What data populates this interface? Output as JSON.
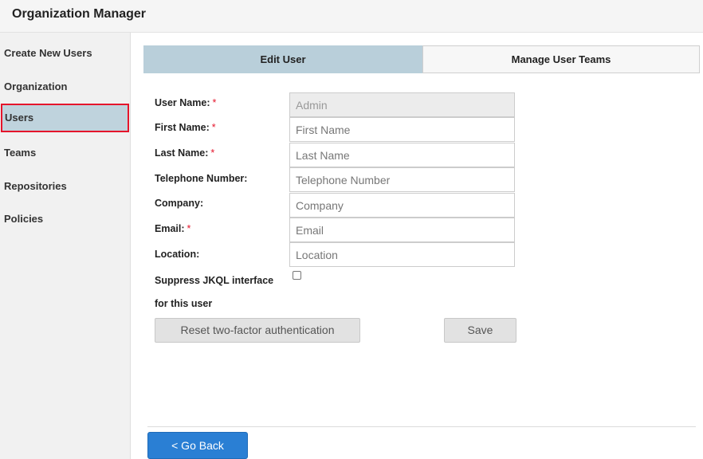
{
  "header": {
    "title": "Organization Manager"
  },
  "sidebar": {
    "items": [
      {
        "label": "Create New Users"
      },
      {
        "label": "Organization"
      },
      {
        "label": "Users"
      },
      {
        "label": "Teams"
      },
      {
        "label": "Repositories"
      },
      {
        "label": "Policies"
      }
    ],
    "selected": "Users"
  },
  "tabs": [
    {
      "label": "Edit User",
      "active": true
    },
    {
      "label": "Manage User Teams",
      "active": false
    }
  ],
  "form": {
    "required_mark": "*",
    "fields": [
      {
        "label": "User Name:",
        "required": true,
        "value": "Admin",
        "placeholder": "",
        "disabled": true
      },
      {
        "label": "First Name:",
        "required": true,
        "value": "",
        "placeholder": "First Name"
      },
      {
        "label": "Last Name:",
        "required": true,
        "value": "",
        "placeholder": "Last Name"
      },
      {
        "label": "Telephone Number:",
        "required": false,
        "value": "",
        "placeholder": "Telephone Number"
      },
      {
        "label": "Company:",
        "required": false,
        "value": "",
        "placeholder": "Company"
      },
      {
        "label": "Email:",
        "required": true,
        "value": "",
        "placeholder": "Email"
      },
      {
        "label": "Location:",
        "required": false,
        "value": "",
        "placeholder": "Location"
      }
    ],
    "suppress_label_line1": "Suppress JKQL interface",
    "suppress_label_line2": "for this user",
    "suppress_checked": false,
    "reset_2fa_label": "Reset two-factor authentication",
    "save_label": "Save"
  },
  "footer": {
    "go_back_label": "< Go Back"
  },
  "colors": {
    "active_tab": "#b9cfda",
    "selected_sidebar": "#bfd3dd",
    "highlight_border": "#e5152b",
    "required": "#e5152b",
    "primary_button": "#2a7fd4"
  }
}
